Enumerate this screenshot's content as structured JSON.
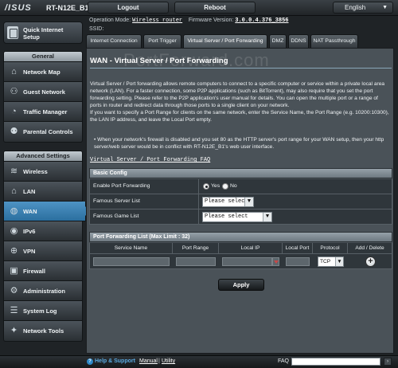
{
  "header": {
    "brand": "/ISUS",
    "model": "RT-N12E_B1",
    "logout_label": "Logout",
    "reboot_label": "Reboot",
    "language": "English"
  },
  "info": {
    "op_mode_label": "Operation Mode:",
    "op_mode_value": "Wireless router",
    "fw_label": "Firmware Version:",
    "fw_value": "3.0.0.4.376_3856",
    "ssid_label": "SSID:"
  },
  "sidebar": {
    "quick_setup": "Quick Internet Setup",
    "general_title": "General",
    "general_items": [
      {
        "label": "Network Map",
        "icon": "network-map-icon"
      },
      {
        "label": "Guest Network",
        "icon": "guest-network-icon"
      },
      {
        "label": "Traffic Manager",
        "icon": "traffic-manager-icon"
      },
      {
        "label": "Parental Controls",
        "icon": "parental-controls-icon"
      }
    ],
    "advanced_title": "Advanced Settings",
    "advanced_items": [
      {
        "label": "Wireless",
        "icon": "wireless-icon"
      },
      {
        "label": "LAN",
        "icon": "lan-icon"
      },
      {
        "label": "WAN",
        "icon": "wan-icon"
      },
      {
        "label": "IPv6",
        "icon": "ipv6-icon"
      },
      {
        "label": "VPN",
        "icon": "vpn-icon"
      },
      {
        "label": "Firewall",
        "icon": "firewall-icon"
      },
      {
        "label": "Administration",
        "icon": "administration-icon"
      },
      {
        "label": "System Log",
        "icon": "system-log-icon"
      },
      {
        "label": "Network Tools",
        "icon": "network-tools-icon"
      }
    ],
    "active_item": "WAN"
  },
  "tabs": [
    {
      "label": "Internet Connection"
    },
    {
      "label": "Port Trigger"
    },
    {
      "label": "Virtual Server / Port Forwarding"
    },
    {
      "label": "DMZ"
    },
    {
      "label": "DDNS"
    },
    {
      "label": "NAT Passthrough"
    }
  ],
  "active_tab": "Virtual Server / Port Forwarding",
  "watermark": "PortForward.com",
  "page": {
    "title": "WAN - Virtual Server / Port Forwarding",
    "description_1": "Virtual Server / Port forwarding allows remote computers to connect to a specific computer or service within a private local area network (LAN). For a faster connection, some P2P applications (such as BitTorrent), may also require that you set the port forwarding setting. Please refer to the P2P application's user manual for details. You can open the multiple port or a range of ports in router and redirect data through those ports to a single client on your network.",
    "description_2": "If you want to specify a Port Range for clients on the same network, enter the Service Name, the Port Range (e.g. 10200:10300), the LAN IP address, and leave the Local Port empty.",
    "bullet": "When your network's firewall is disabled and you set 80 as the HTTP server's port range for your WAN setup, then your http server/web server would be in conflict with RT-N12E_B1's web user interface.",
    "faq_link": "Virtual Server / Port Forwarding FAQ"
  },
  "basic_config": {
    "title": "Basic Config",
    "enable_label": "Enable Port Forwarding",
    "yes_label": "Yes",
    "no_label": "No",
    "enabled": true,
    "famous_server_label": "Famous Server List",
    "famous_server_value": "Please select",
    "famous_game_label": "Famous Game List",
    "famous_game_value": "Please select"
  },
  "pf_list": {
    "title": "Port Forwarding List (Max Limit : 32)",
    "columns": [
      "Service Name",
      "Port Range",
      "Local IP",
      "Local Port",
      "Protocol",
      "Add / Delete"
    ],
    "protocol_value": "TCP"
  },
  "apply_label": "Apply",
  "footer": {
    "help_label": "Help & Support",
    "manual_label": "Manual",
    "separator": "|",
    "utility_label": "Utility",
    "faq_label": "FAQ"
  }
}
